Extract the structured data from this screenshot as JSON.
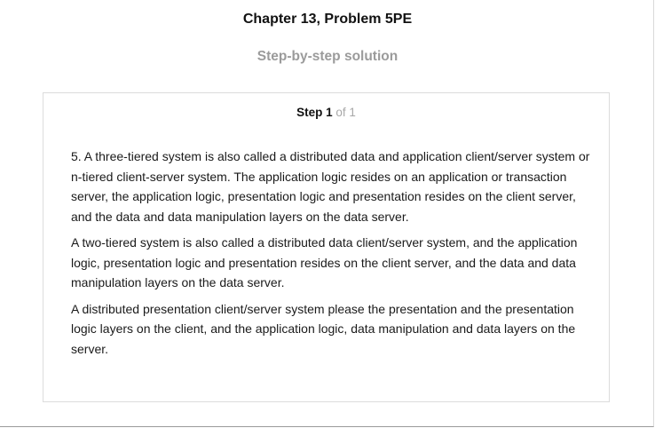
{
  "header": {
    "chapter_title": "Chapter 13, Problem 5PE",
    "solution_heading": "Step-by-step solution"
  },
  "step": {
    "label": "Step 1",
    "of_text": "of 1",
    "paragraphs": [
      "5. A three-tiered system is also called a distributed data and application client/server system or n-tiered client-server system. The application logic resides on an application or transaction server, the application logic, presentation logic and presentation resides on the client server, and the data and data manipulation layers on the data server.",
      "A two-tiered system is also called a distributed data client/server system, and the application logic, presentation logic and presentation resides on the client server, and the data and data manipulation layers on the data server.",
      "A distributed presentation client/server system please the presentation and the presentation logic layers on the client, and the application logic, data manipulation and data layers on the server."
    ]
  }
}
